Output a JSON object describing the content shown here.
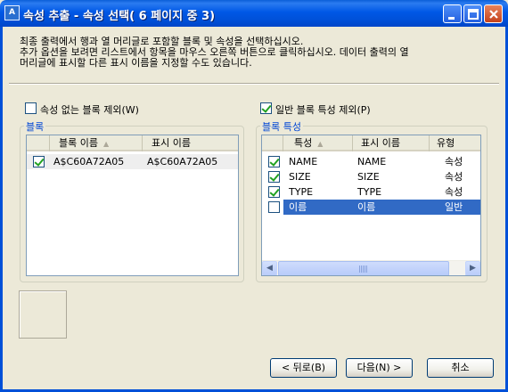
{
  "window": {
    "title": "속성 추출 - 속성 선택( 6 페이지 중 3)",
    "app_icon": "ac-icon"
  },
  "instructions": {
    "line1": "최종 출력에서 행과 열 머리글로 포함할 블록 및 속성을 선택하십시오.",
    "line2": "추가 옵션을 보려면 리스트에서 항목을 마우스 오른쪽 버튼으로 클릭하십시오. 데이터 출력의 열",
    "line3": "머리글에 표시할 다른 표시 이름을 지정할 수도 있습니다."
  },
  "options": {
    "exclude_no_attr_label": "속성 없는 블록 제외(W)",
    "exclude_no_attr_checked": false,
    "exclude_general_label": "일반 블록 특성 제외(P)",
    "exclude_general_checked": true
  },
  "blocks_group": {
    "title": "블록",
    "columns": [
      "블록 이름",
      "표시 이름"
    ],
    "rows": [
      {
        "checked": true,
        "name": "A$C60A72A05",
        "display": "A$C60A72A05"
      }
    ]
  },
  "props_group": {
    "title": "블록 특성",
    "columns": [
      "특성",
      "표시 이름",
      "유형"
    ],
    "rows": [
      {
        "checked": true,
        "prop": "NAME",
        "display": "NAME",
        "type": "속성"
      },
      {
        "checked": true,
        "prop": "SIZE",
        "display": "SIZE",
        "type": "속성"
      },
      {
        "checked": true,
        "prop": "TYPE",
        "display": "TYPE",
        "type": "속성"
      },
      {
        "checked": false,
        "prop": "이름",
        "display": "이름",
        "type": "일반",
        "selected": true
      }
    ]
  },
  "buttons": {
    "back": "< 뒤로(B)",
    "next": "다음(N) >",
    "cancel": "취소"
  }
}
